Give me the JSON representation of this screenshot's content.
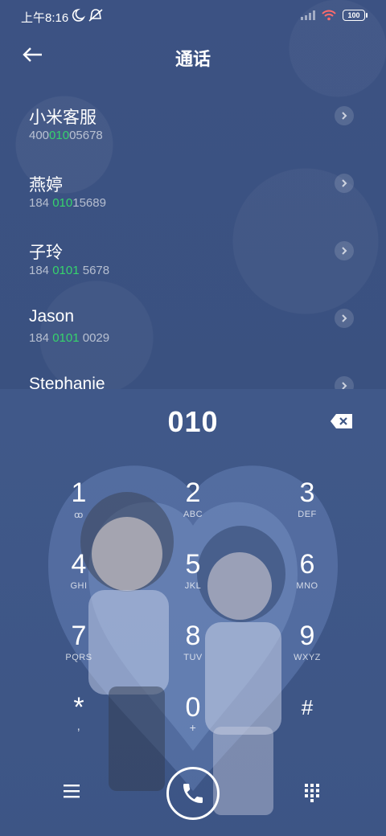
{
  "status": {
    "time": "上午8:16",
    "battery": "100"
  },
  "header": {
    "title": "通话"
  },
  "contacts": [
    {
      "name": "小米客服",
      "num_pre": "400",
      "num_hl": "010",
      "num_post": "05678"
    },
    {
      "name": "燕婷",
      "num_pre": "184 ",
      "num_hl": "010",
      "num_post": "15689"
    },
    {
      "name": "子玲",
      "num_pre": "184 ",
      "num_hl": "0101",
      "num_post": " 5678"
    },
    {
      "name": "Jason",
      "num_pre": "184 ",
      "num_hl": "0101",
      "num_post": " 0029"
    },
    {
      "name": "Stephanie",
      "num_pre": "",
      "num_hl": "",
      "num_post": ""
    }
  ],
  "dialer": {
    "entry": "010",
    "keys": [
      {
        "digit": "1",
        "letters": "ꝏ"
      },
      {
        "digit": "2",
        "letters": "ABC"
      },
      {
        "digit": "3",
        "letters": "DEF"
      },
      {
        "digit": "4",
        "letters": "GHI"
      },
      {
        "digit": "5",
        "letters": "JKL"
      },
      {
        "digit": "6",
        "letters": "MNO"
      },
      {
        "digit": "7",
        "letters": "PQRS"
      },
      {
        "digit": "8",
        "letters": "TUV"
      },
      {
        "digit": "9",
        "letters": "WXYZ"
      },
      {
        "digit": "*",
        "letters": ","
      },
      {
        "digit": "0",
        "letters": "+"
      },
      {
        "digit": "#",
        "letters": ""
      }
    ]
  },
  "colors": {
    "background": "#3b5282",
    "highlight": "#36d46c"
  },
  "icons": {
    "back": "arrow-left-icon",
    "backspace": "backspace-icon",
    "menu": "menu-icon",
    "call": "phone-icon",
    "keypad": "dialpad-icon"
  }
}
